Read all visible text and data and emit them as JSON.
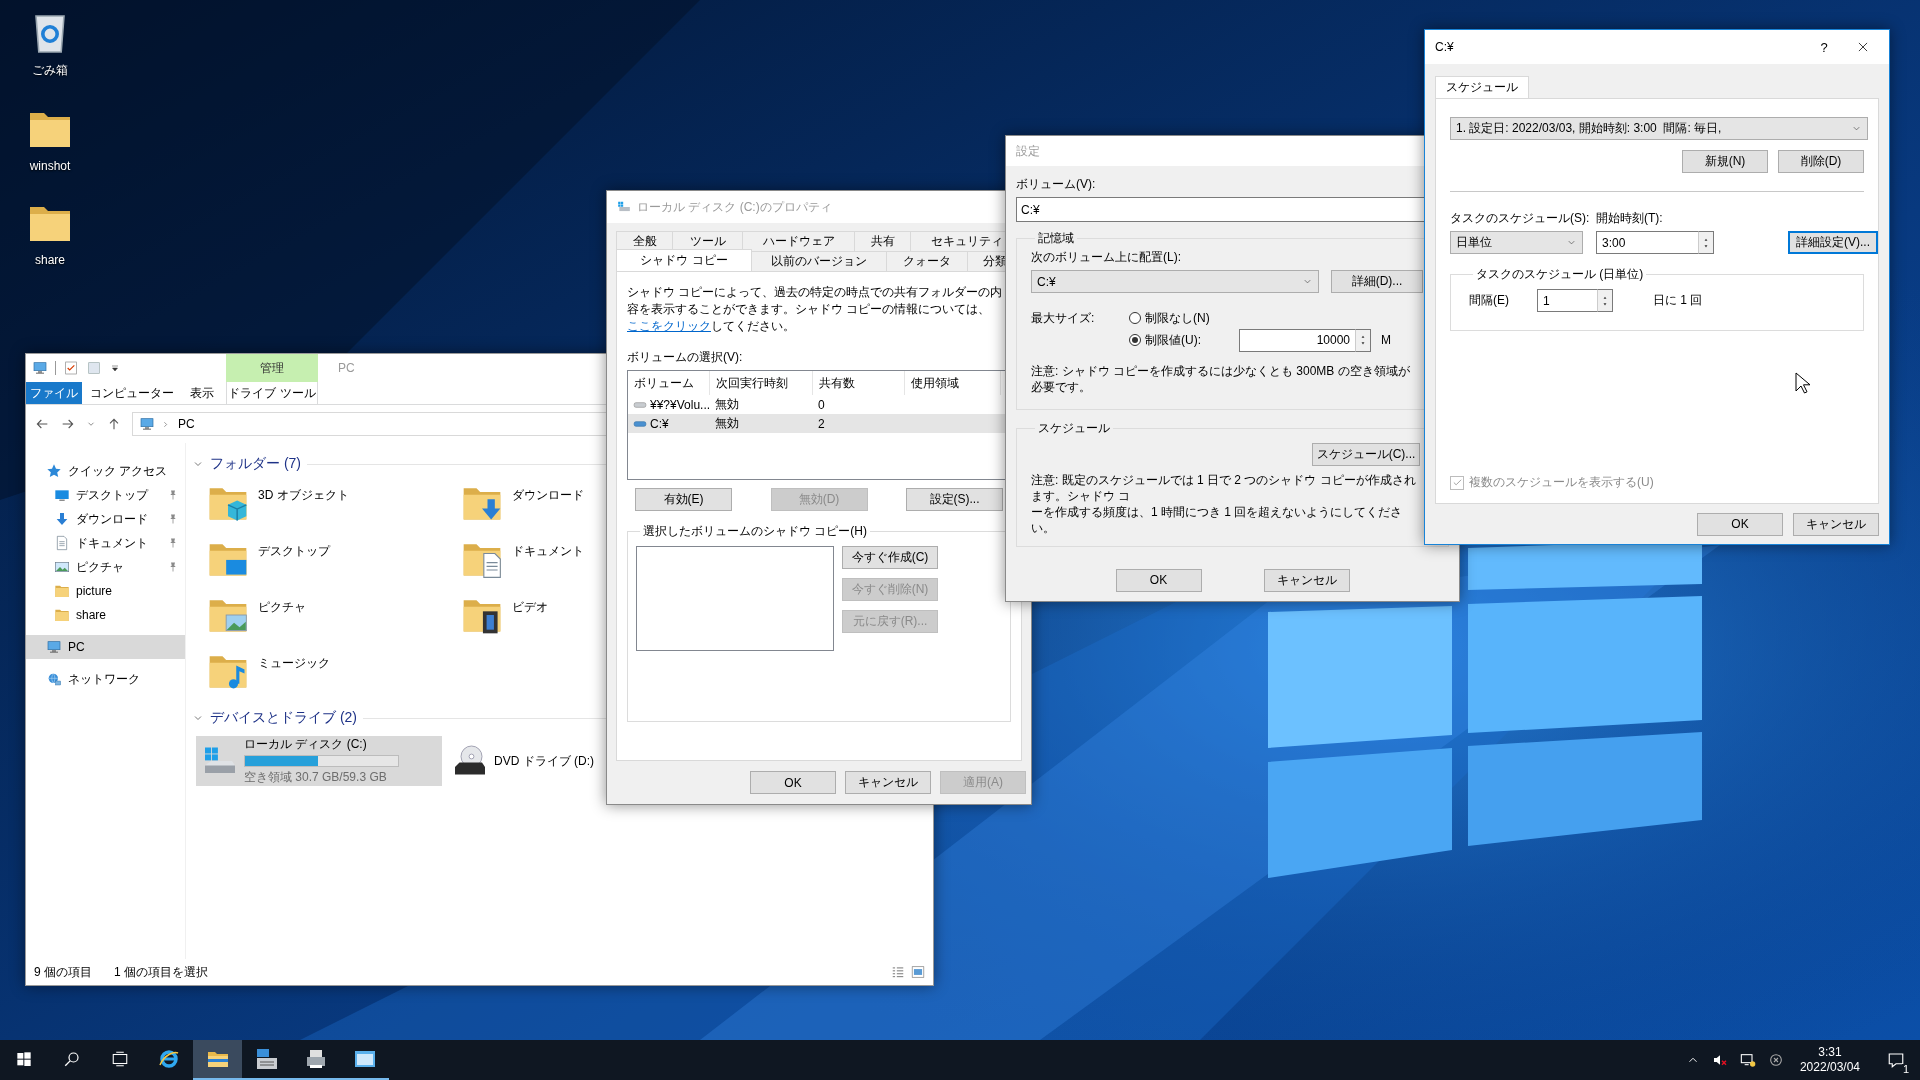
{
  "desktop": {
    "icons": [
      {
        "label": "ごみ箱",
        "kind": "bin"
      },
      {
        "label": "winshot",
        "kind": "folder"
      },
      {
        "label": "share",
        "kind": "folder"
      }
    ]
  },
  "explorer": {
    "title": "PC",
    "context_group": "管理",
    "ribbon_tabs": [
      {
        "label": "ファイル",
        "kind": "file"
      },
      {
        "label": "コンピューター",
        "kind": "tab"
      },
      {
        "label": "表示",
        "kind": "tab"
      },
      {
        "label": "ドライブ ツール",
        "kind": "context"
      }
    ],
    "address": "PC",
    "nav": [
      {
        "label": "クイック アクセス",
        "kind": "star",
        "selected": false,
        "children": [
          {
            "label": "デスクトップ",
            "kind": "desktop",
            "pinned": true,
            "selected": false
          },
          {
            "label": "ダウンロード",
            "kind": "download",
            "pinned": true,
            "selected": false
          },
          {
            "label": "ドキュメント",
            "kind": "document",
            "pinned": true,
            "selected": false
          },
          {
            "label": "ピクチャ",
            "kind": "pictures",
            "pinned": true,
            "selected": false
          },
          {
            "label": "picture",
            "kind": "folder",
            "pinned": false,
            "selected": false
          },
          {
            "label": "share",
            "kind": "folder",
            "pinned": false,
            "selected": false
          }
        ]
      },
      {
        "label": "PC",
        "kind": "pc",
        "selected": true
      },
      {
        "label": "ネットワーク",
        "kind": "network",
        "selected": false
      }
    ],
    "folders": {
      "title": "フォルダー (7)",
      "expanded": true,
      "items": [
        {
          "label": "3D オブジェクト",
          "kind": "cube"
        },
        {
          "label": "ダウンロード",
          "kind": "download"
        },
        {
          "label": "デスクトップ",
          "kind": "desktop"
        },
        {
          "label": "ドキュメント",
          "kind": "document"
        },
        {
          "label": "ピクチャ",
          "kind": "pictures"
        },
        {
          "label": "ビデオ",
          "kind": "video"
        },
        {
          "label": "ミュージック",
          "kind": "music"
        }
      ]
    },
    "drives": {
      "title": "デバイスとドライブ (2)",
      "expanded": true,
      "items": [
        {
          "label": "ローカル ディスク (C:)",
          "kind": "hdd",
          "selected": true,
          "level": 0.48,
          "free": "空き領域 30.7 GB/59.3 GB"
        },
        {
          "label": "DVD ドライブ (D:)",
          "kind": "dvd",
          "selected": false
        }
      ]
    },
    "status": [
      "9 個の項目",
      "1 個の項目を選択"
    ]
  },
  "properties": {
    "title": "ローカル ディスク (C:)のプロパティ",
    "tab_rows": [
      [
        {
          "label": "全般",
          "selected": false
        },
        {
          "label": "ツール",
          "selected": false
        },
        {
          "label": "ハードウェア",
          "selected": false
        },
        {
          "label": "共有",
          "selected": false
        },
        {
          "label": "セキュリティ",
          "selected": false
        }
      ],
      [
        {
          "label": "シャドウ コピー",
          "selected": true
        },
        {
          "label": "以前のバージョン",
          "selected": false
        },
        {
          "label": "クォータ",
          "selected": false
        },
        {
          "label": "分類",
          "selected": false
        }
      ]
    ],
    "description": {
      "text": "シャドウ コピーによって、過去の特定の時点での共有フォルダーの内容を表示することができます。シャドウ コピーの情報については、",
      "link": "ここをクリック",
      "after": "してください。"
    },
    "volume_label": "ボリュームの選択(V):",
    "columns": [
      "ボリューム",
      "次回実行時刻",
      "共有数",
      "使用領域"
    ],
    "rows": [
      {
        "kind": "volume",
        "cells": [
          "¥¥?¥Volu...",
          "無効",
          "0"
        ],
        "selected": false
      },
      {
        "kind": "drive",
        "cells": [
          "C:¥",
          "無効",
          "2"
        ],
        "selected": true
      }
    ],
    "volume_buttons": [
      {
        "label": "有効(E)",
        "disabled": false
      },
      {
        "label": "無効(D)",
        "disabled": true
      },
      {
        "label": "設定(S)...",
        "disabled": false
      }
    ],
    "copies_group": "選択したボリュームのシャドウ コピー(H)",
    "copy_buttons": [
      {
        "label": "今すぐ作成(C)",
        "disabled": false
      },
      {
        "label": "今すぐ削除(N)",
        "disabled": true
      },
      {
        "label": "元に戻す(R)...",
        "disabled": true
      }
    ],
    "footer": [
      {
        "label": "OK",
        "disabled": false
      },
      {
        "label": "キャンセル",
        "disabled": false
      },
      {
        "label": "適用(A)",
        "disabled": true
      }
    ]
  },
  "settings": {
    "title": "設定",
    "volume_label": "ボリューム(V):",
    "volume": "C:¥",
    "storage_group": "記憶域",
    "location_label": "次のボリューム上に配置(L):",
    "location": "C:¥",
    "details_button": "詳細(D)...",
    "max_size_label": "最大サイズ:",
    "size_options": [
      {
        "label": "制限なし(N)",
        "selected": false
      },
      {
        "label": "制限値(U):",
        "selected": true
      }
    ],
    "limit": "10000",
    "unit": "M",
    "storage_note": "注意: シャドウ コピーを作成するには少なくとも 300MB の空き領域が必要です。",
    "schedule_group": "スケジュール",
    "schedule_button": "スケジュール(C)...",
    "schedule_note": [
      "注意: 既定のスケジュールでは 1 日で 2 つのシャドウ コピーが作成されます。シャドウ コ",
      "ーを作成する頻度は、1 時間につき 1 回を超えないようにしてください。"
    ],
    "footer": [
      "OK",
      "キャンセル"
    ]
  },
  "schedule": {
    "title": "C:¥",
    "help": "?",
    "tabs": [
      {
        "label": "スケジュール",
        "selected": true
      }
    ],
    "schedule": "1. 設定日: 2022/03/03, 開始時刻: 3:00  間隔: 毎日,",
    "buttons": [
      "新規(N)",
      "削除(D)"
    ],
    "task_label": "タスクのスケジュール(S):",
    "task_value": "日単位",
    "start_label": "開始時刻(T):",
    "start_value": "3:00",
    "advanced": {
      "label": "詳細設定(V)...",
      "focused": true
    },
    "group": "タスクのスケジュール (日単位)",
    "interval_label": "間隔(E)",
    "interval": "1",
    "interval_suffix": "日に 1 回",
    "multiple": {
      "label": "複数のスケジュールを表示する(U)",
      "checked": true,
      "disabled": true
    },
    "footer": [
      "OK",
      "キャンセル"
    ]
  },
  "taskbar": {
    "apps": [
      {
        "kind": "ie",
        "running": false,
        "selected": false
      },
      {
        "kind": "explorer",
        "running": true,
        "selected": true
      },
      {
        "kind": "server",
        "running": true,
        "selected": false
      },
      {
        "kind": "tool",
        "running": true,
        "selected": false
      },
      {
        "kind": "window",
        "running": true,
        "selected": false
      }
    ],
    "time": "3:31",
    "date": "2022/03/04",
    "notifications": "1"
  }
}
